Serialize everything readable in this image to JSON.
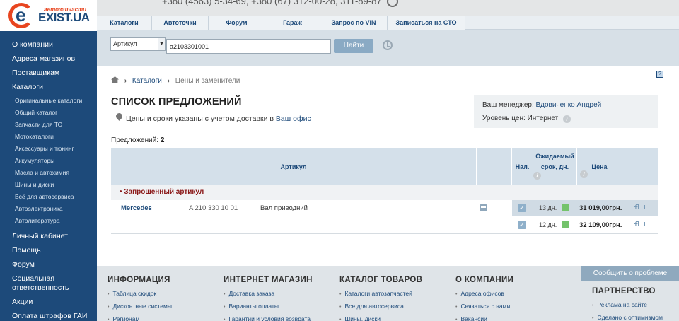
{
  "logo": {
    "sub": "автозапчасти",
    "brand": "EXIST.UA",
    "letter": "e"
  },
  "header": {
    "phones": "+380 (4563) 5-34-69, +380 (67) 312-00-28, 311-89-87"
  },
  "menu": [
    {
      "label": "Каталоги"
    },
    {
      "label": "Автоточки"
    },
    {
      "label": "Форум"
    },
    {
      "label": "Гараж"
    },
    {
      "label": "Запрос по VIN"
    },
    {
      "label": "Записаться на СТО"
    }
  ],
  "sidebar": {
    "items_top": [
      "О компании",
      "Адреса магазинов",
      "Поставщикам",
      "Каталоги"
    ],
    "sub_items": [
      "Оригинальные каталоги",
      "Общий каталог",
      "Запчасти для ТО",
      "Мотокаталоги",
      "Аксессуары и тюнинг",
      "Аккумуляторы",
      "Масла и автохимия",
      "Шины и диски",
      "Всё для автосервиса",
      "Автоэлектроника",
      "Автолитература"
    ],
    "items_bottom": [
      "Личный кабинет",
      "Помощь",
      "Форум",
      "Социальная ответственность",
      "Акции",
      "Оплата штрафов ГАИ"
    ]
  },
  "search": {
    "select_value": "Артикул",
    "input_value": "a2103301001",
    "button_label": "Найти"
  },
  "breadcrumb": {
    "catalogs": "Каталоги",
    "current": "Цены и заменители"
  },
  "page": {
    "title": "СПИСОК ПРЕДЛОЖЕНИЙ",
    "delivery_note": "Цены и сроки указаны с учетом доставки в",
    "delivery_link": "Ваш офис",
    "offers_label": "Предложений:",
    "offers_count": "2"
  },
  "manager": {
    "label": "Ваш менеджер:",
    "name": "Вдовиченко Андрей",
    "price_level_label": "Уровень цен:",
    "price_level": "Интернет"
  },
  "table": {
    "headers": {
      "article": "Артикул",
      "availability": "Нал.",
      "expected_line1": "Ожидаемый",
      "expected_line2": "срок, дн.",
      "price": "Цена"
    },
    "group_label": "• Запрошенный артикул",
    "rows": [
      {
        "brand": "Mercedes",
        "article": "A 210 330 10 01",
        "description": "Вал приводний",
        "days": "13 дн.",
        "price": "31 019,00грн.",
        "checked": true,
        "highlight": true
      },
      {
        "brand": "",
        "article": "",
        "description": "",
        "days": "12 дн.",
        "price": "32 109,00грн.",
        "checked": true,
        "highlight": false
      }
    ]
  },
  "footer": {
    "report_button": "Сообщить о проблеме",
    "columns": [
      {
        "title": "ИНФОРМАЦИЯ",
        "links": [
          "Таблица скидок",
          "Дисконтные системы",
          "Регионам"
        ]
      },
      {
        "title": "ИНТЕРНЕТ МАГАЗИН",
        "links": [
          "Доставка заказа",
          "Варианты оплаты",
          "Гарантии и условия возврата"
        ]
      },
      {
        "title": "КАТАЛОГ ТОВАРОВ",
        "links": [
          "Каталоги автозапчастей",
          "Все для автосервиса",
          "Шины, диски"
        ]
      },
      {
        "title": "О КОМПАНИИ",
        "links": [
          "Адреса офисов",
          "Связаться с нами",
          "Вакансии"
        ]
      }
    ],
    "partnership": {
      "title": "ПАРТНЕРСТВО",
      "links": [
        "Реклама на сайте",
        "Сделано с оптимизмом"
      ]
    }
  },
  "colors": {
    "sidebar": "#1d4a7a",
    "accent": "#e8451f",
    "button": "#8aaac4",
    "price_ok": "#74c36c",
    "group_label": "#8b1a1a"
  },
  "icons": [
    "home-icon",
    "pin-icon",
    "history-icon",
    "clock-icon",
    "info-icon",
    "bus-icon",
    "cart-icon",
    "checkbox-icon",
    "help-icon"
  ]
}
